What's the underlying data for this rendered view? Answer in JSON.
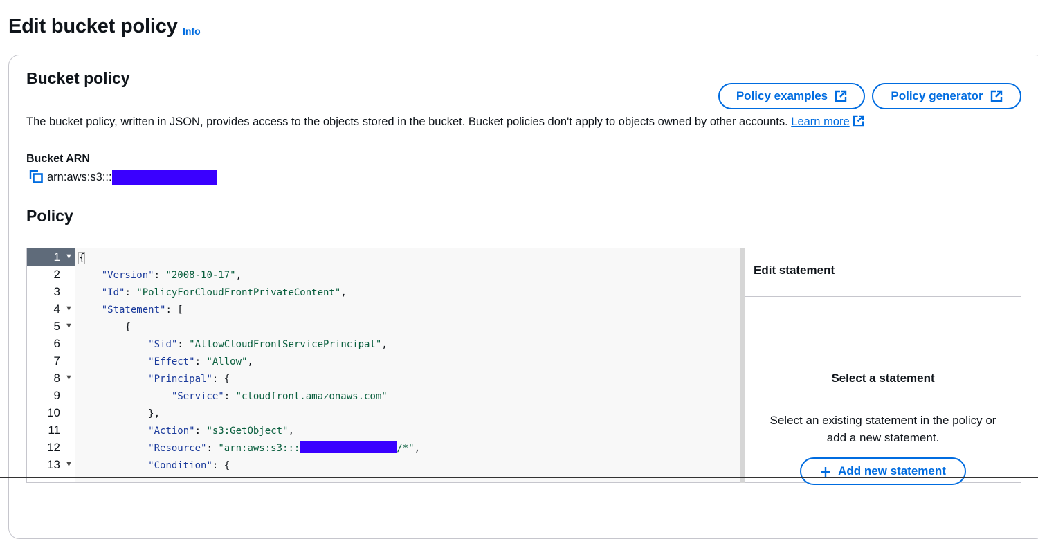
{
  "header": {
    "title": "Edit bucket policy",
    "info_label": "Info"
  },
  "bucket_policy": {
    "title": "Bucket policy",
    "policy_examples_label": "Policy examples",
    "policy_generator_label": "Policy generator",
    "description": "The bucket policy, written in JSON, provides access to the objects stored in the bucket. Bucket policies don't apply to objects owned by other accounts.",
    "learn_more_label": "Learn more",
    "arn_label": "Bucket ARN",
    "arn_prefix": "arn:aws:s3:::"
  },
  "policy": {
    "title": "Policy",
    "lines": [
      {
        "num": "1",
        "fold": true
      },
      {
        "num": "2",
        "fold": false
      },
      {
        "num": "3",
        "fold": false
      },
      {
        "num": "4",
        "fold": true
      },
      {
        "num": "5",
        "fold": true
      },
      {
        "num": "6",
        "fold": false
      },
      {
        "num": "7",
        "fold": false
      },
      {
        "num": "8",
        "fold": true
      },
      {
        "num": "9",
        "fold": false
      },
      {
        "num": "10",
        "fold": false
      },
      {
        "num": "11",
        "fold": false
      },
      {
        "num": "12",
        "fold": false
      },
      {
        "num": "13",
        "fold": true
      }
    ],
    "code": {
      "l1": "{",
      "version_key": "\"Version\"",
      "version_val": "\"2008-10-17\"",
      "id_key": "\"Id\"",
      "id_val": "\"PolicyForCloudFrontPrivateContent\"",
      "statement_key": "\"Statement\"",
      "l5": "{",
      "sid_key": "\"Sid\"",
      "sid_val": "\"AllowCloudFrontServicePrincipal\"",
      "effect_key": "\"Effect\"",
      "effect_val": "\"Allow\"",
      "principal_key": "\"Principal\"",
      "service_key": "\"Service\"",
      "service_val": "\"cloudfront.amazonaws.com\"",
      "l10": "},",
      "action_key": "\"Action\"",
      "action_val": "\"s3:GetObject\"",
      "resource_key": "\"Resource\"",
      "resource_val_prefix": "\"arn:aws:s3:::",
      "resource_val_suffix": "/*\"",
      "condition_key": "\"Condition\""
    }
  },
  "side_panel": {
    "title": "Edit statement",
    "select_title": "Select a statement",
    "select_desc_line1": "Select an existing statement in the policy or",
    "select_desc_line2": "add a new statement.",
    "add_label": "Add new statement"
  },
  "colors": {
    "accent": "#006ce0",
    "redaction": "#3a00ff"
  },
  "icons": [
    "external-link-icon",
    "copy-icon",
    "fold-arrow-icon",
    "plus-icon"
  ]
}
